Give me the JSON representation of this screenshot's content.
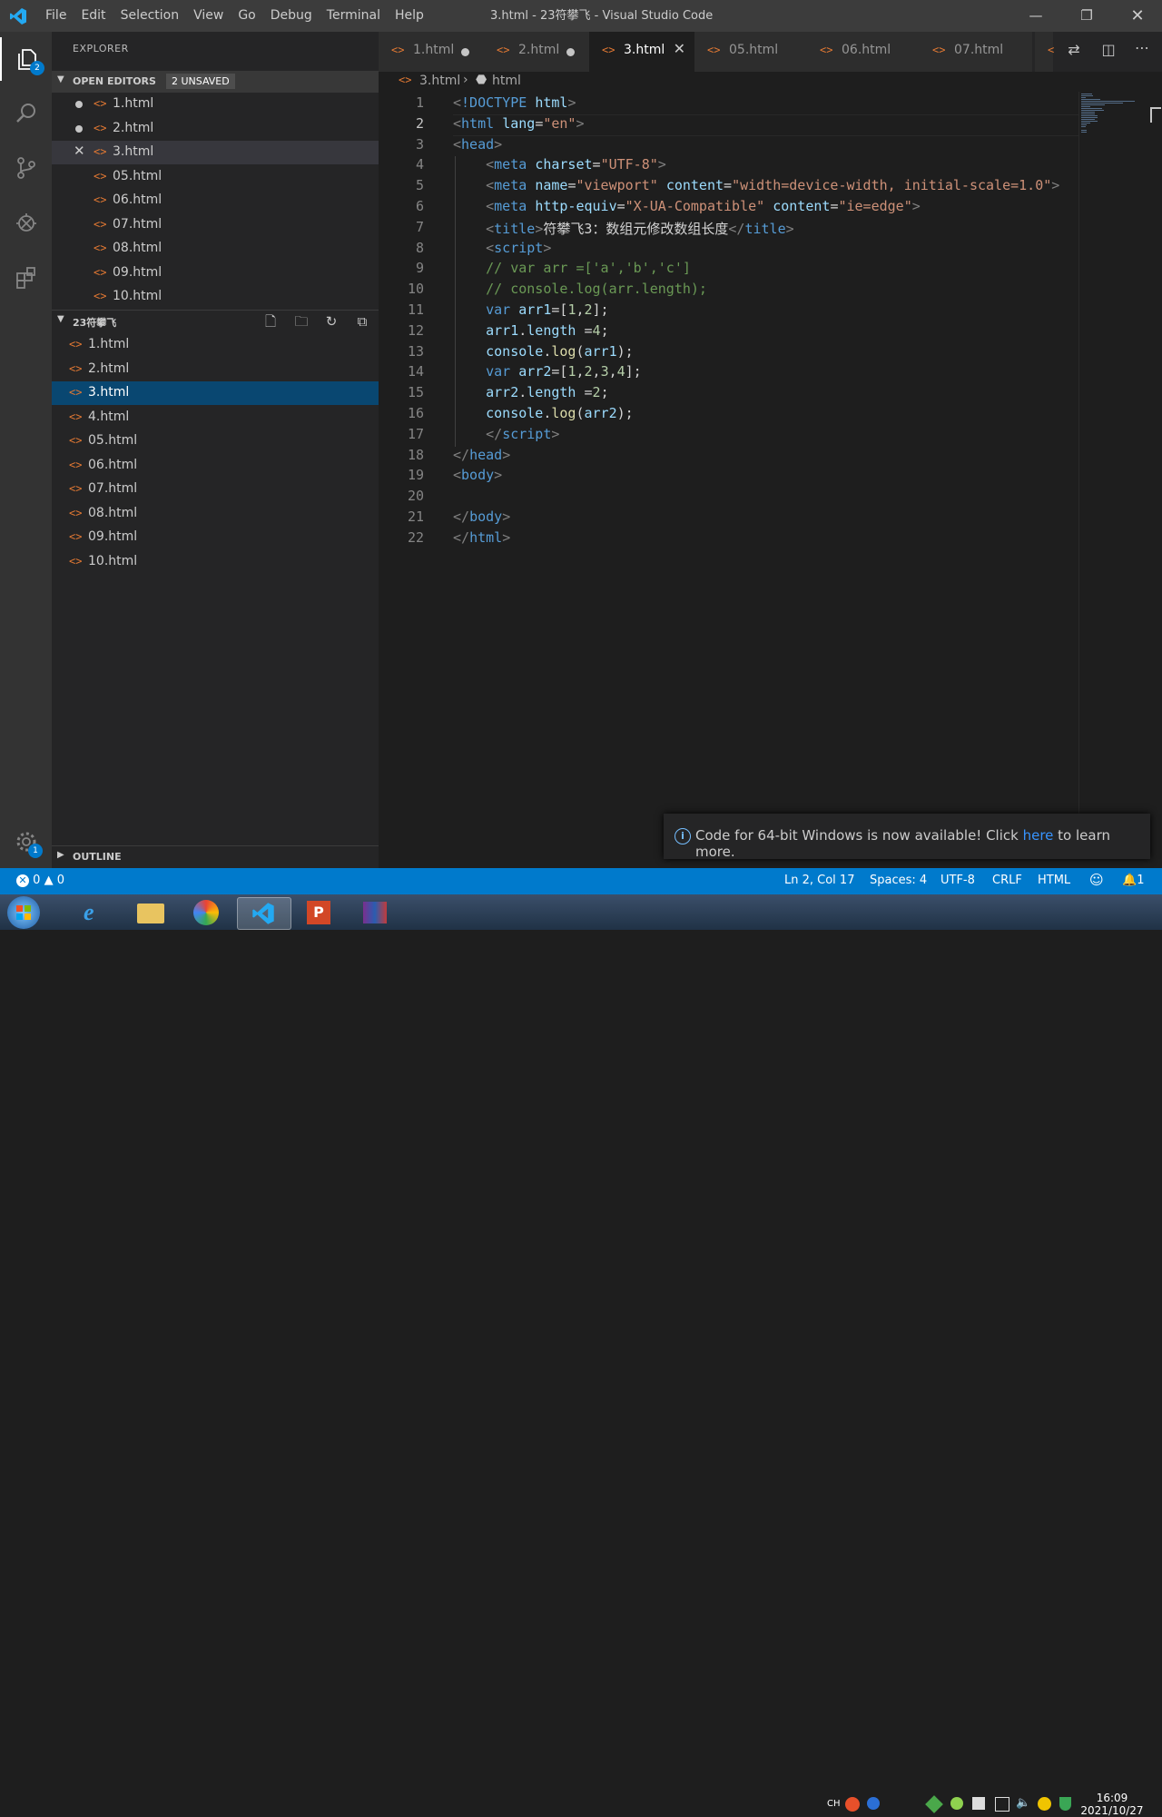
{
  "titlebar": {
    "menus": [
      "File",
      "Edit",
      "Selection",
      "View",
      "Go",
      "Debug",
      "Terminal",
      "Help"
    ],
    "title": "3.html - 23符攀飞 - Visual Studio Code"
  },
  "activity": {
    "explorer_badge": "2",
    "settings_badge": "1"
  },
  "sidebar": {
    "title": "EXPLORER",
    "open_editors": {
      "label": "OPEN EDITORS",
      "unsaved": "2 UNSAVED",
      "items": [
        "1.html",
        "2.html",
        "3.html",
        "05.html",
        "06.html",
        "07.html",
        "08.html",
        "09.html",
        "10.html"
      ]
    },
    "folder": {
      "label": "23符攀飞",
      "items": [
        "1.html",
        "2.html",
        "3.html",
        "4.html",
        "05.html",
        "06.html",
        "07.html",
        "08.html",
        "09.html",
        "10.html"
      ]
    },
    "outline_label": "OUTLINE"
  },
  "tabs": [
    "1.html",
    "2.html",
    "3.html",
    "05.html",
    "06.html",
    "07.html"
  ],
  "breadcrumb": {
    "file": "3.html",
    "symbol": "html"
  },
  "editor": {
    "line_numbers": [
      "1",
      "2",
      "3",
      "4",
      "5",
      "6",
      "7",
      "8",
      "9",
      "10",
      "11",
      "12",
      "13",
      "14",
      "15",
      "16",
      "17",
      "18",
      "19",
      "20",
      "21",
      "22"
    ],
    "lines": [
      [
        [
          "t-brk",
          "<"
        ],
        [
          "t-tag",
          "!DOCTYPE "
        ],
        [
          "t-attr",
          "html"
        ],
        [
          "t-brk",
          ">"
        ]
      ],
      [
        [
          "t-brk",
          "<"
        ],
        [
          "t-tag",
          "html "
        ],
        [
          "t-attr",
          "lang"
        ],
        [
          "t-txt",
          "="
        ],
        [
          "t-str",
          "\"en\""
        ],
        [
          "t-brk",
          ">"
        ]
      ],
      [
        [
          "t-brk",
          "<"
        ],
        [
          "t-tag",
          "head"
        ],
        [
          "t-brk",
          ">"
        ]
      ],
      [
        [
          "t-txt",
          "    "
        ],
        [
          "t-brk",
          "<"
        ],
        [
          "t-tag",
          "meta "
        ],
        [
          "t-attr",
          "charset"
        ],
        [
          "t-txt",
          "="
        ],
        [
          "t-str",
          "\"UTF-8\""
        ],
        [
          "t-brk",
          ">"
        ]
      ],
      [
        [
          "t-txt",
          "    "
        ],
        [
          "t-brk",
          "<"
        ],
        [
          "t-tag",
          "meta "
        ],
        [
          "t-attr",
          "name"
        ],
        [
          "t-txt",
          "="
        ],
        [
          "t-str",
          "\"viewport\""
        ],
        [
          "t-txt",
          " "
        ],
        [
          "t-attr",
          "content"
        ],
        [
          "t-txt",
          "="
        ],
        [
          "t-str",
          "\"width=device-width, initial-scale=1.0\""
        ],
        [
          "t-brk",
          ">"
        ]
      ],
      [
        [
          "t-txt",
          "    "
        ],
        [
          "t-brk",
          "<"
        ],
        [
          "t-tag",
          "meta "
        ],
        [
          "t-attr",
          "http-equiv"
        ],
        [
          "t-txt",
          "="
        ],
        [
          "t-str",
          "\"X-UA-Compatible\""
        ],
        [
          "t-txt",
          " "
        ],
        [
          "t-attr",
          "content"
        ],
        [
          "t-txt",
          "="
        ],
        [
          "t-str",
          "\"ie=edge\""
        ],
        [
          "t-brk",
          ">"
        ]
      ],
      [
        [
          "t-txt",
          "    "
        ],
        [
          "t-brk",
          "<"
        ],
        [
          "t-tag",
          "title"
        ],
        [
          "t-brk",
          ">"
        ],
        [
          "t-txt",
          "符攀飞3：数组元修改数组长度"
        ],
        [
          "t-brk",
          "</"
        ],
        [
          "t-tag",
          "title"
        ],
        [
          "t-brk",
          ">"
        ]
      ],
      [
        [
          "t-txt",
          "    "
        ],
        [
          "t-brk",
          "<"
        ],
        [
          "t-tag",
          "script"
        ],
        [
          "t-brk",
          ">"
        ]
      ],
      [
        [
          "t-txt",
          "    "
        ],
        [
          "t-com",
          "// var arr =['a','b','c']"
        ]
      ],
      [
        [
          "t-txt",
          "    "
        ],
        [
          "t-com",
          "// console.log(arr.length);"
        ]
      ],
      [
        [
          "t-txt",
          "    "
        ],
        [
          "t-kw",
          "var "
        ],
        [
          "t-var",
          "arr1"
        ],
        [
          "t-txt",
          "=["
        ],
        [
          "t-num",
          "1"
        ],
        [
          "t-txt",
          ","
        ],
        [
          "t-num",
          "2"
        ],
        [
          "t-txt",
          "];"
        ]
      ],
      [
        [
          "t-txt",
          "    "
        ],
        [
          "t-var",
          "arr1"
        ],
        [
          "t-txt",
          "."
        ],
        [
          "t-var",
          "length"
        ],
        [
          "t-txt",
          " ="
        ],
        [
          "t-num",
          "4"
        ],
        [
          "t-txt",
          ";"
        ]
      ],
      [
        [
          "t-txt",
          "    "
        ],
        [
          "t-var",
          "console"
        ],
        [
          "t-txt",
          "."
        ],
        [
          "t-fn",
          "log"
        ],
        [
          "t-txt",
          "("
        ],
        [
          "t-var",
          "arr1"
        ],
        [
          "t-txt",
          ");"
        ]
      ],
      [
        [
          "t-txt",
          "    "
        ],
        [
          "t-kw",
          "var "
        ],
        [
          "t-var",
          "arr2"
        ],
        [
          "t-txt",
          "=["
        ],
        [
          "t-num",
          "1"
        ],
        [
          "t-txt",
          ","
        ],
        [
          "t-num",
          "2"
        ],
        [
          "t-txt",
          ","
        ],
        [
          "t-num",
          "3"
        ],
        [
          "t-txt",
          ","
        ],
        [
          "t-num",
          "4"
        ],
        [
          "t-txt",
          "];"
        ]
      ],
      [
        [
          "t-txt",
          "    "
        ],
        [
          "t-var",
          "arr2"
        ],
        [
          "t-txt",
          "."
        ],
        [
          "t-var",
          "length"
        ],
        [
          "t-txt",
          " ="
        ],
        [
          "t-num",
          "2"
        ],
        [
          "t-txt",
          ";"
        ]
      ],
      [
        [
          "t-txt",
          "    "
        ],
        [
          "t-var",
          "console"
        ],
        [
          "t-txt",
          "."
        ],
        [
          "t-fn",
          "log"
        ],
        [
          "t-txt",
          "("
        ],
        [
          "t-var",
          "arr2"
        ],
        [
          "t-txt",
          ");"
        ]
      ],
      [
        [
          "t-txt",
          "    "
        ],
        [
          "t-brk",
          "</"
        ],
        [
          "t-tag",
          "script"
        ],
        [
          "t-brk",
          ">"
        ]
      ],
      [
        [
          "t-brk",
          "</"
        ],
        [
          "t-tag",
          "head"
        ],
        [
          "t-brk",
          ">"
        ]
      ],
      [
        [
          "t-brk",
          "<"
        ],
        [
          "t-tag",
          "body"
        ],
        [
          "t-brk",
          ">"
        ]
      ],
      [
        [
          "t-txt",
          ""
        ]
      ],
      [
        [
          "t-brk",
          "</"
        ],
        [
          "t-tag",
          "body"
        ],
        [
          "t-brk",
          ">"
        ]
      ],
      [
        [
          "t-brk",
          "</"
        ],
        [
          "t-tag",
          "html"
        ],
        [
          "t-brk",
          ">"
        ]
      ]
    ]
  },
  "toast": {
    "before": "Code for 64-bit Windows is now available! Click ",
    "link": "here",
    "after": " to learn more."
  },
  "status": {
    "errors": "0",
    "warnings": "0",
    "position": "Ln 2, Col 17",
    "spaces": "Spaces: 4",
    "encoding": "UTF-8",
    "eol": "CRLF",
    "language": "HTML",
    "notifications": "1"
  },
  "taskbar": {
    "ime": "CH",
    "time": "16:09",
    "date": "2021/10/27"
  }
}
